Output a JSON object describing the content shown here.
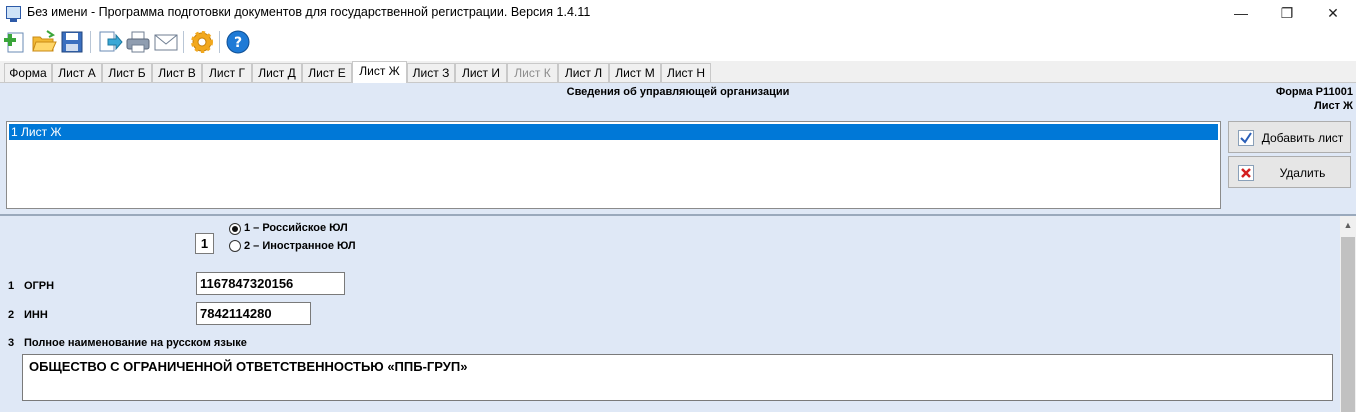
{
  "window": {
    "title": "Без имени - Программа подготовки документов для государственной регистрации. Версия 1.4.11",
    "minimize_glyph": "—",
    "maximize_glyph": "❐",
    "close_glyph": "✕"
  },
  "toolbar": {
    "buttons": [
      {
        "icon": "new-document-icon",
        "color": "#3aa53a"
      },
      {
        "icon": "open-folder-icon",
        "color": "#f2b935"
      },
      {
        "icon": "save-icon",
        "color": "#3a6fbf"
      },
      {
        "icon": "export-icon",
        "color": "#3aa8d6"
      },
      {
        "icon": "print-icon",
        "color": "#6f7e92"
      },
      {
        "icon": "mail-icon",
        "color": "#6f7e92"
      },
      {
        "icon": "settings-icon",
        "color": "#f2a81d"
      },
      {
        "icon": "help-icon",
        "color": "#1e7ad6"
      }
    ]
  },
  "tabs": [
    {
      "label": "Форма",
      "state": "normal"
    },
    {
      "label": "Лист А",
      "state": "normal"
    },
    {
      "label": "Лист Б",
      "state": "normal"
    },
    {
      "label": "Лист В",
      "state": "normal"
    },
    {
      "label": "Лист Г",
      "state": "normal"
    },
    {
      "label": "Лист Д",
      "state": "normal"
    },
    {
      "label": "Лист Е",
      "state": "normal"
    },
    {
      "label": "Лист Ж",
      "state": "active"
    },
    {
      "label": "Лист З",
      "state": "normal"
    },
    {
      "label": "Лист И",
      "state": "normal"
    },
    {
      "label": "Лист К",
      "state": "disabled"
    },
    {
      "label": "Лист Л",
      "state": "normal"
    },
    {
      "label": "Лист М",
      "state": "normal"
    },
    {
      "label": "Лист Н",
      "state": "normal"
    }
  ],
  "header": {
    "section_title": "Сведения об управляющей организации",
    "form_code": "Форма Р11001",
    "sheet_code": "Лист Ж"
  },
  "sheet_list": {
    "items": [
      "1 Лист Ж"
    ],
    "selected_color": "#0078d7"
  },
  "actions": {
    "add_label": "Добавить лист",
    "delete_label": "Удалить"
  },
  "form": {
    "org_type_value": "1",
    "org_type_options": [
      "1 – Российское ЮЛ",
      "2 – Иностранное ЮЛ"
    ],
    "selected_option": "1 – Российское ЮЛ",
    "ogrn": {
      "num": "1",
      "label": "ОГРН",
      "value": "1167847320156"
    },
    "inn": {
      "num": "2",
      "label": "ИНН",
      "value": "7842114280"
    },
    "full_name": {
      "num": "3",
      "label": "Полное наименование на русском языке",
      "value": "ОБЩЕСТВО С ОГРАНИЧЕННОЙ ОТВЕТСТВЕННОСТЬЮ «ППБ-ГРУП»"
    }
  },
  "scrollbar": {
    "up_arrow": "▲"
  },
  "colors": {
    "panel_bg": "#dfe8f6",
    "selection": "#0078d7"
  }
}
